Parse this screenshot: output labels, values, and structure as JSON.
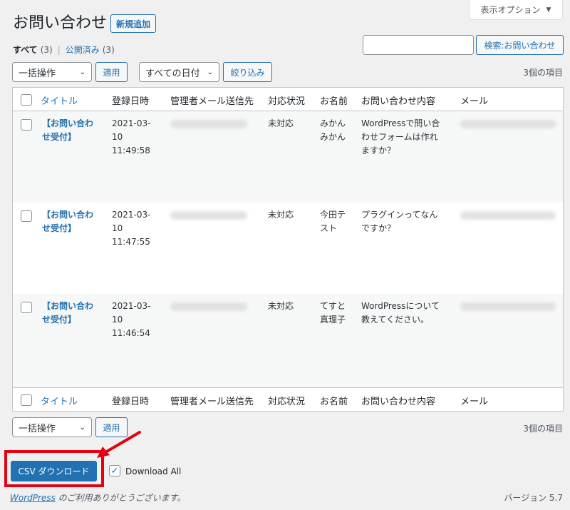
{
  "screen_options": {
    "label": "表示オプション",
    "icon": "triangle-down-icon"
  },
  "header": {
    "title": "お問い合わせ",
    "add_new": "新規追加"
  },
  "views": {
    "all_label": "すべて",
    "all_count": "(3)",
    "published_label": "公開済み",
    "published_count": "(3)",
    "separator": "|"
  },
  "search": {
    "placeholder": "",
    "button": "検索:お問い合わせ"
  },
  "top_nav": {
    "bulk_action": "一括操作",
    "apply": "適用",
    "date_filter": "すべての日付",
    "filter": "絞り込み",
    "item_count": "3個の項目"
  },
  "columns": [
    "タイトル",
    "登録日時",
    "管理者メール送信先",
    "対応状況",
    "お名前",
    "お問い合わせ内容",
    "メール"
  ],
  "rows": [
    {
      "title_line1": "【お問い合わ",
      "title_line2": "せ受付】",
      "date1": "2021-03-",
      "date2": "10",
      "time": "11:49:58",
      "status": "未対応",
      "name1": "みかん",
      "name2": "みかん",
      "content1": "WordPressで問い合",
      "content2": "わせフォームは作れ",
      "content3": "ますか？"
    },
    {
      "title_line1": "【お問い合わ",
      "title_line2": "せ受付】",
      "date1": "2021-03-",
      "date2": "10",
      "time": "11:47:55",
      "status": "未対応",
      "name1": "今田テ",
      "name2": "スト",
      "content1": "プラグインってなん",
      "content2": "ですか？",
      "content3": ""
    },
    {
      "title_line1": "【お問い合わ",
      "title_line2": "せ受付】",
      "date1": "2021-03-",
      "date2": "10",
      "time": "11:46:54",
      "status": "未対応",
      "name1": "てすと",
      "name2": "真理子",
      "content1": "WordPressについて",
      "content2": "教えてください。",
      "content3": ""
    }
  ],
  "bottom_nav": {
    "bulk_action": "一括操作",
    "apply": "適用",
    "item_count": "3個の項目"
  },
  "csv": {
    "button": "CSV ダウンロード",
    "download_all": "Download All",
    "download_all_checked": true
  },
  "footer": {
    "wp_link": "WordPress",
    "thanks": " のご利用ありがとうございます。",
    "version": "バージョン 5.7"
  },
  "colors": {
    "accent": "#2271b1",
    "highlight": "#e50012"
  }
}
